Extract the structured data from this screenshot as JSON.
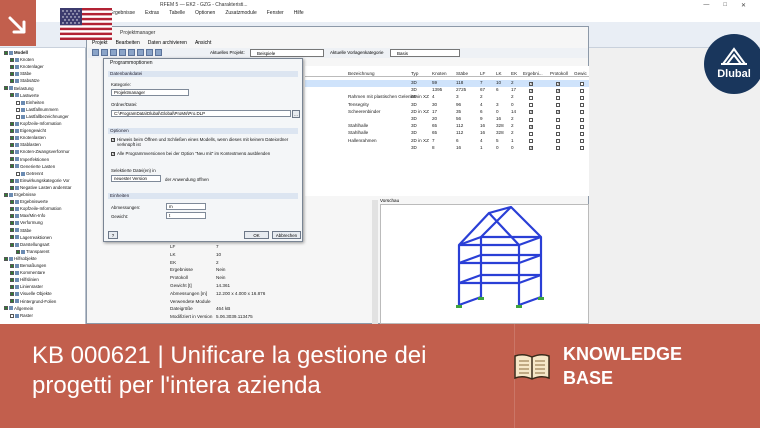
{
  "app": {
    "title": "RFEM 5 — EK2 - GZG - Charakteristi...",
    "menu": [
      "Ergebnisse",
      "Extras",
      "Tabelle",
      "Optionen",
      "Zusatzmodule",
      "Fenster",
      "Hilfe"
    ],
    "win_controls": [
      "—",
      "□",
      "✕"
    ]
  },
  "navigator": {
    "items": [
      {
        "label": "Modell",
        "checked": true,
        "bold": true
      },
      {
        "label": "Knoten",
        "checked": true
      },
      {
        "label": "Knotenlager",
        "checked": true
      },
      {
        "label": "Stäbe",
        "checked": true
      },
      {
        "label": "Stabsätze",
        "checked": true
      },
      {
        "label": "Belastung",
        "checked": true
      },
      {
        "label": "Lastwerte",
        "checked": true
      },
      {
        "label": "Einheiten",
        "checked": false
      },
      {
        "label": "Lastfallnummern",
        "checked": false
      },
      {
        "label": "Lastfallbezeichnunger",
        "checked": false
      },
      {
        "label": "Kopfzeile-Information",
        "checked": true
      },
      {
        "label": "Eigengewicht",
        "checked": true
      },
      {
        "label": "Knotenlasten",
        "checked": true
      },
      {
        "label": "Stablasten",
        "checked": true
      },
      {
        "label": "Knoten-Zwangsverformur",
        "checked": true
      },
      {
        "label": "Imperfektionen",
        "checked": true
      },
      {
        "label": "Generierte Lasten",
        "checked": true
      },
      {
        "label": "Getrennt",
        "checked": false
      },
      {
        "label": "Einwirkungskategorie Vor",
        "checked": true
      },
      {
        "label": "Negative Lasten anderstar",
        "checked": true
      },
      {
        "label": "Ergebnisse",
        "checked": true
      },
      {
        "label": "Ergebniswerte",
        "checked": true
      },
      {
        "label": "Kopfzeile-Information",
        "checked": true
      },
      {
        "label": "Max/Min-Info",
        "checked": true
      },
      {
        "label": "Verformung",
        "checked": true
      },
      {
        "label": "Stäbe",
        "checked": true
      },
      {
        "label": "Lagerreaktionen",
        "checked": true
      },
      {
        "label": "Darstellungsart",
        "checked": true
      },
      {
        "label": "Transparent",
        "checked": true
      },
      {
        "label": "Hilfsobjekte",
        "checked": true
      },
      {
        "label": "Bemaßungen",
        "checked": true
      },
      {
        "label": "Kommentare",
        "checked": true
      },
      {
        "label": "Hilfslinien",
        "checked": true
      },
      {
        "label": "Linienraster",
        "checked": true
      },
      {
        "label": "Visuelle Objekte",
        "checked": true
      },
      {
        "label": "Hintergrund-Folien",
        "checked": true
      },
      {
        "label": "Allgemein",
        "checked": true
      },
      {
        "label": "Raster",
        "checked": false
      }
    ]
  },
  "project_manager": {
    "title": "Projektmanager",
    "menu": [
      "Projekt",
      "Bearbeiten",
      "Daten archivieren",
      "Ansicht"
    ],
    "active_project_label": "Aktuelles Projekt:",
    "active_project": "Beispiele",
    "template_label": "Aktuelle Vorlagenkategorie",
    "template_value": "Basis",
    "columns": [
      "Bezeichnung",
      "Typ",
      "Knoten",
      "Stäbe",
      "LF",
      "LK",
      "EK",
      "Ergebni...",
      "Protokoll",
      "Gewic"
    ],
    "rows": [
      {
        "name": "",
        "typ": "3D",
        "knoten": "59",
        "staebe": "118",
        "lf": "7",
        "lk": "10",
        "ek": "2",
        "erg": true,
        "prot": true
      },
      {
        "name": "",
        "typ": "3D",
        "knoten": "1395",
        "staebe": "2725",
        "lf": "67",
        "lk": "6",
        "ek": "17",
        "erg": true,
        "prot": true
      },
      {
        "name": "Rahmen mit plastischen Gelenken",
        "typ": "2D in XZ",
        "knoten": "4",
        "staebe": "3",
        "lf": "2",
        "lk": "",
        "ek": "2",
        "erg": false,
        "prot": false
      },
      {
        "name": "Tensegrity",
        "typ": "3D",
        "knoten": "30",
        "staebe": "96",
        "lf": "4",
        "lk": "3",
        "ek": "0",
        "erg": false,
        "prot": false
      },
      {
        "name": "Scheerenbinder",
        "typ": "2D in XZ",
        "knoten": "17",
        "staebe": "35",
        "lf": "6",
        "lk": "0",
        "ek": "14",
        "erg": true,
        "prot": true
      },
      {
        "name": "",
        "typ": "3D",
        "knoten": "20",
        "staebe": "56",
        "lf": "9",
        "lk": "16",
        "ek": "2",
        "erg": false,
        "prot": false
      },
      {
        "name": "Stahlhalle",
        "typ": "3D",
        "knoten": "65",
        "staebe": "112",
        "lf": "16",
        "lk": "328",
        "ek": "2",
        "erg": true,
        "prot": false
      },
      {
        "name": "Stahlhalle",
        "typ": "3D",
        "knoten": "65",
        "staebe": "112",
        "lf": "16",
        "lk": "328",
        "ek": "2",
        "erg": false,
        "prot": false
      },
      {
        "name": "Hallenrahmen",
        "typ": "2D in XZ",
        "knoten": "7",
        "staebe": "6",
        "lf": "4",
        "lk": "5",
        "ek": "1",
        "erg": false,
        "prot": false
      },
      {
        "name": "",
        "typ": "3D",
        "knoten": "8",
        "staebe": "16",
        "lf": "1",
        "lk": "0",
        "ek": "0",
        "erg": true,
        "prot": false
      }
    ],
    "preview_label": "Vorschau",
    "properties": [
      {
        "key": "LF",
        "val": "7"
      },
      {
        "key": "LK",
        "val": "10"
      },
      {
        "key": "EK",
        "val": "2"
      },
      {
        "key": "Ergebnisse",
        "val": "Nein"
      },
      {
        "key": "Protokoll",
        "val": "Nein"
      },
      {
        "key": "Gewicht [t]",
        "val": "14.361"
      },
      {
        "key": "Abmessungen [m]",
        "val": "12.200 x 4.000 x 16.876"
      },
      {
        "key": "Verwendete Module",
        "val": ""
      },
      {
        "key": "Dateigröße",
        "val": "464 kB"
      },
      {
        "key": "Modifiziert in Version",
        "val": "5.06.3039.113475"
      }
    ]
  },
  "dialog": {
    "title": "Programmoptionen",
    "sec_datenbankdatei": "Datenbankdatei",
    "kategorie_label": "Kategorie:",
    "kategorie_value": "Projektmanager",
    "ordner_label": "Ordner/Datei:",
    "ordner_value": "C:\\ProgramData\\Dlubal\\Global\\ProMs\\Pro.DLP",
    "sec_optionen": "Optionen",
    "opt1": "Hinweis beim Öffnen und Schließen eines Modells, wenn dieses mit keinem Dateiordner verknüpft ist",
    "opt2": "Alle Programmversionen bei der Option \"Neu mit\" im Kontextmenü ausblenden",
    "select_label": "Selektierte Datei(en) in",
    "select_value": "neuester Version",
    "select_suffix": "der Anwendung öffnen",
    "sec_einheiten": "Einheiten",
    "abm_label": "Abmessungen:",
    "abm_value": "m",
    "gew_label": "Gewicht:",
    "gew_value": "t",
    "ok": "OK",
    "cancel": "Abbrechen"
  },
  "badge": {
    "logo_text": "Dlubal"
  },
  "banner": {
    "title": "KB 000621 | Unificare la gestione dei progetti per l'intera azienda",
    "label_line1": "KNOWLEDGE",
    "label_line2": "BASE",
    "color": "#c25f4d"
  }
}
